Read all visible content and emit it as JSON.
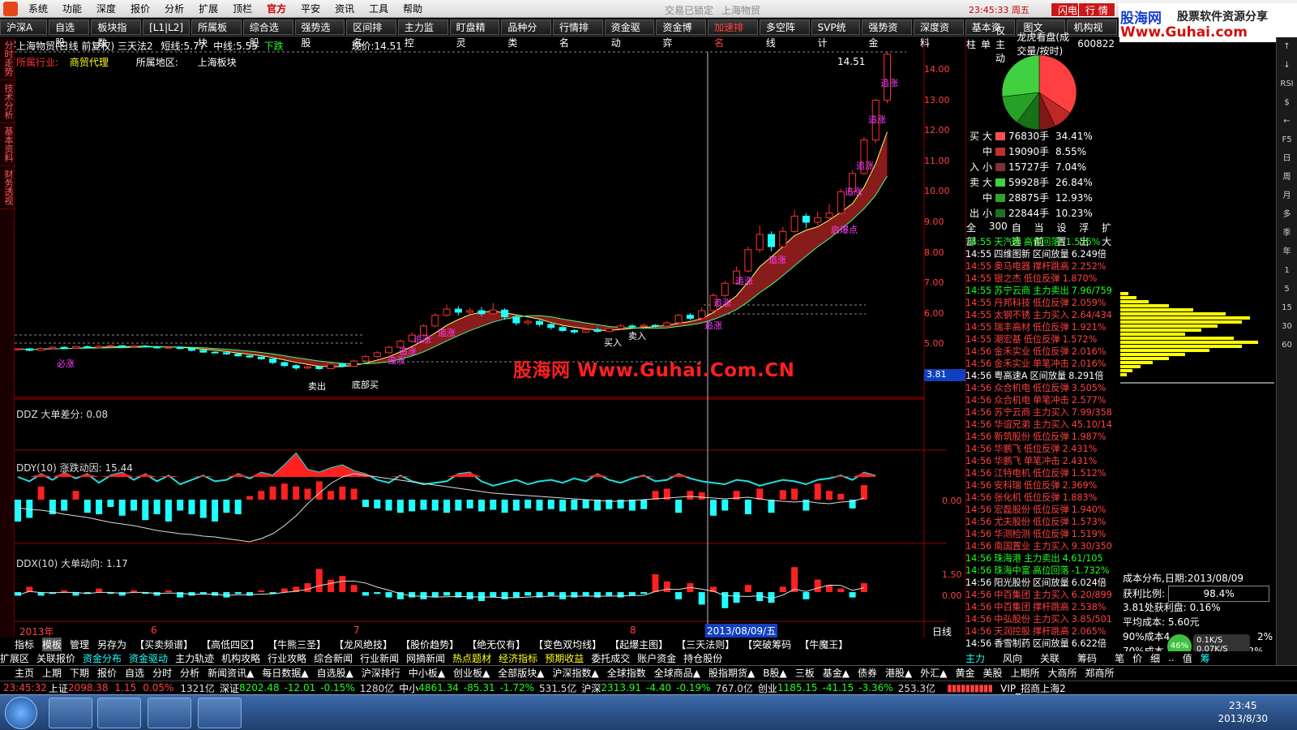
{
  "menu": [
    "系统",
    "功能",
    "深度",
    "报价",
    "分析",
    "扩展",
    "顶栏",
    "官方",
    "平安",
    "资讯",
    "工具",
    "帮助"
  ],
  "window_status": "交易已锁定",
  "window_stock": "上海物贸",
  "clock_top": "23:45:33 周五",
  "btn_trade": "闪电手",
  "btn_quote": "行 情",
  "brand": {
    "title": "股海网",
    "subtitle": "股票软件资源分享",
    "url": "Www.Guhai.com"
  },
  "toolbar": [
    "沪深A股",
    "自选股",
    "板块指数",
    "[L1|L2]",
    "所属板块",
    "综合选股",
    "强势选股",
    "区间排名",
    "主力监控",
    "盯盘精灵",
    "品种分类",
    "行情排名",
    "资金驱动",
    "资金博弈",
    "加速排名",
    "多空阵线",
    "SVP统计",
    "强势资金",
    "深度资料",
    "基本资料",
    "图文F10",
    "机构视点"
  ],
  "left_tabs": [
    "分时走势",
    "技术分析",
    "基本资料",
    "财务透视"
  ],
  "chart_header": {
    "title": "上海物贸(日线 前复权) 三天法2",
    "short_label": "短线:",
    "short_val": "5.77",
    "mid_label": "中线:",
    "mid_val": "5.55",
    "trend": "下跌",
    "now_label": "现价:",
    "now_val": "14.51"
  },
  "industry": {
    "label": "所属行业:",
    "value": "商贸代理",
    "region_label": "所属地区:",
    "region_value": "上海板块"
  },
  "price_axis": [
    "14.00",
    "13.00",
    "12.00",
    "11.00",
    "10.00",
    "9.00",
    "8.00",
    "7.00",
    "6.00",
    "5.00"
  ],
  "price_top_label": "14.51",
  "current_price_tag": "3.81",
  "watermark": "股海网 Www.Guhai.Com.CN",
  "annotations": [
    "追涨",
    "追涨",
    "追涨",
    "追涨",
    "追涨",
    "追涨",
    "追涨",
    "启爆点",
    "追涨",
    "买入",
    "卖入",
    "追涨",
    "必涨",
    "追涨",
    "追涨",
    "追涨",
    "卖出",
    "底部买"
  ],
  "indicators": {
    "ddz_title": "DDZ 大单差分:",
    "ddz_val": "0.08",
    "ddy_title": "DDY(10) 涨跌动因:",
    "ddy_val": "15.44",
    "ddx_title": "DDX(10) 大单动向:",
    "ddx_val": "1.17",
    "ddy_axis": "0.00",
    "ddx_axis1": "1.50",
    "ddx_axis2": "0.00"
  },
  "x_axis": {
    "year": "2013年",
    "m6": "6",
    "m7": "7",
    "m8": "8",
    "cursor_date": "2013/08/09/五",
    "period": "日线"
  },
  "right_tabs": [
    "柱",
    "单",
    "仅主动",
    "龙虎看盘(成交量/按时)",
    "600822"
  ],
  "flow": {
    "buy_label": "买",
    "in_label": "入",
    "sell_label": "卖",
    "out_label": "出",
    "rows": [
      {
        "size": "大",
        "vol": "76830手",
        "pct": "34.41%",
        "color": "#ff5050"
      },
      {
        "size": "中",
        "vol": "19090手",
        "pct": "8.55%",
        "color": "#c03030"
      },
      {
        "size": "小",
        "vol": "15727手",
        "pct": "7.04%",
        "color": "#803030"
      },
      {
        "size": "大",
        "vol": "59928手",
        "pct": "26.84%",
        "color": "#40d040"
      },
      {
        "size": "中",
        "vol": "28875手",
        "pct": "12.93%",
        "color": "#30a030"
      },
      {
        "size": "小",
        "vol": "22844手",
        "pct": "10.23%",
        "color": "#207020"
      }
    ]
  },
  "pie": [
    {
      "value": 34.41,
      "color": "#ff4040"
    },
    {
      "value": 8.55,
      "color": "#c02828"
    },
    {
      "value": 7.04,
      "color": "#801818"
    },
    {
      "value": 10.23,
      "color": "#187018"
    },
    {
      "value": 12.93,
      "color": "#28a028"
    },
    {
      "value": 26.84,
      "color": "#40d040"
    }
  ],
  "alert_tabs": [
    "全部",
    "300",
    "自选",
    "当前",
    "设置",
    "浮出",
    "扩大"
  ],
  "alerts": [
    {
      "t": "14:55",
      "n": "天汽模",
      "e": "高位回落",
      "v": "-1.576%",
      "c": "#20ff20"
    },
    {
      "t": "14:55",
      "n": "四维图新",
      "e": "区间放量",
      "v": "6.249倍",
      "c": "#fff"
    },
    {
      "t": "14:55",
      "n": "奥马电器",
      "e": "撑杆跳高",
      "v": "2.252%",
      "c": "#ff4040"
    },
    {
      "t": "14:55",
      "n": "银之杰",
      "e": "低位反弹",
      "v": "1.870%",
      "c": "#ff4040"
    },
    {
      "t": "14:55",
      "n": "苏宁云商",
      "e": "主力卖出",
      "v": "7.96/759",
      "c": "#20ff20"
    },
    {
      "t": "14:55",
      "n": "丹邦科技",
      "e": "低位反弹",
      "v": "2.059%",
      "c": "#ff4040"
    },
    {
      "t": "14:55",
      "n": "太钢不锈",
      "e": "主力买入",
      "v": "2.64/434",
      "c": "#ff4040"
    },
    {
      "t": "14:55",
      "n": "瑞丰高材",
      "e": "低位反弹",
      "v": "1.921%",
      "c": "#ff4040"
    },
    {
      "t": "14:55",
      "n": "潮宏基",
      "e": "低位反弹",
      "v": "1.572%",
      "c": "#ff4040"
    },
    {
      "t": "14:56",
      "n": "金禾实业",
      "e": "低位反弹",
      "v": "2.016%",
      "c": "#ff4040"
    },
    {
      "t": "14:56",
      "n": "金禾实业",
      "e": "单笔冲击",
      "v": "2.016%",
      "c": "#ff4040"
    },
    {
      "t": "14:56",
      "n": "粤高速A",
      "e": "区间放量",
      "v": "8.291倍",
      "c": "#fff"
    },
    {
      "t": "14:56",
      "n": "众合机电",
      "e": "低位反弹",
      "v": "3.505%",
      "c": "#ff4040"
    },
    {
      "t": "14:56",
      "n": "众合机电",
      "e": "单笔冲击",
      "v": "2.577%",
      "c": "#ff4040"
    },
    {
      "t": "14:56",
      "n": "苏宁云商",
      "e": "主力买入",
      "v": "7.99/358",
      "c": "#ff4040"
    },
    {
      "t": "14:56",
      "n": "华谊兄弟",
      "e": "主力买入",
      "v": "45.10/14",
      "c": "#ff4040"
    },
    {
      "t": "14:56",
      "n": "新筑股份",
      "e": "低位反弹",
      "v": "1.987%",
      "c": "#ff4040"
    },
    {
      "t": "14:56",
      "n": "华鹏飞",
      "e": "低位反弹",
      "v": "2.431%",
      "c": "#ff4040"
    },
    {
      "t": "14:56",
      "n": "华鹏飞",
      "e": "单笔冲击",
      "v": "2.431%",
      "c": "#ff4040"
    },
    {
      "t": "14:56",
      "n": "江特电机",
      "e": "低位反弹",
      "v": "1.512%",
      "c": "#ff4040"
    },
    {
      "t": "14:56",
      "n": "安科瑞",
      "e": "低位反弹",
      "v": "2.369%",
      "c": "#ff4040"
    },
    {
      "t": "14:56",
      "n": "张化机",
      "e": "低位反弹",
      "v": "1.883%",
      "c": "#ff4040"
    },
    {
      "t": "14:56",
      "n": "宏磊股份",
      "e": "低位反弹",
      "v": "1.940%",
      "c": "#ff4040"
    },
    {
      "t": "14:56",
      "n": "尤夫股份",
      "e": "低位反弹",
      "v": "1.573%",
      "c": "#ff4040"
    },
    {
      "t": "14:56",
      "n": "华测检测",
      "e": "低位反弹",
      "v": "1.519%",
      "c": "#ff4040"
    },
    {
      "t": "14:56",
      "n": "南国置业",
      "e": "主力买入",
      "v": "9.30/350",
      "c": "#ff4040"
    },
    {
      "t": "14:56",
      "n": "珠海港",
      "e": "主力卖出",
      "v": "4.61/105",
      "c": "#20ff20"
    },
    {
      "t": "14:56",
      "n": "珠海中富",
      "e": "高位回落",
      "v": "-1.732%",
      "c": "#20ff20"
    },
    {
      "t": "14:56",
      "n": "阳光股份",
      "e": "区间放量",
      "v": "6.024倍",
      "c": "#fff"
    },
    {
      "t": "14:56",
      "n": "中百集团",
      "e": "主力买入",
      "v": "6.20/899",
      "c": "#ff4040"
    },
    {
      "t": "14:56",
      "n": "中百集团",
      "e": "撑杆跳高",
      "v": "2.538%",
      "c": "#ff4040"
    },
    {
      "t": "14:56",
      "n": "中弘股份",
      "e": "主力买入",
      "v": "3.85/501",
      "c": "#ff4040"
    },
    {
      "t": "14:56",
      "n": "天润控股",
      "e": "撑杆跳高",
      "v": "2.065%",
      "c": "#ff4040"
    },
    {
      "t": "14:56",
      "n": "香雪制药",
      "e": "区间放量",
      "v": "6.622倍",
      "c": "#fff"
    }
  ],
  "cost": {
    "title": "成本分布,日期:",
    "date": "2013/08/09",
    "profit_label": "获利比例:",
    "profit_val": "98.4%",
    "c1": "3.81处获利盘: 0.16%",
    "c2": "平均成本: 5.60元",
    "c3": "90%成本4.",
    "c3b": "2%",
    "c4": "70%成本",
    "c4b": "2%"
  },
  "netspeed": {
    "pct": "46%",
    "up": "0.1K/S",
    "down": "0.07K/S"
  },
  "bottom_tabs": [
    "指标",
    "模板",
    "管理",
    "另存为",
    "【买卖频谱】",
    "【高低四区】",
    "【牛熊三圣】",
    "【龙风绝技】",
    "【股价趋势】",
    "【绝无仅有】",
    "【变色双均线】",
    "【起爆主图】",
    "【三天法则】",
    "【突破筹码",
    "【牛魔王】"
  ],
  "bottom_tabs2": [
    "扩展区",
    "关联报价",
    "资金分布",
    "资金驱动",
    "主力轨迹",
    "机构攻略",
    "行业攻略",
    "综合新闻",
    "行业新闻",
    "网摘新闻",
    "热点题材",
    "经济指标",
    "预期收益",
    "委托成交",
    "账户资金",
    "持仓股份"
  ],
  "right_bottom_tabs": [
    "主力",
    "风向",
    "关联",
    "筹码"
  ],
  "right_bottom_tabs_b": [
    "笔",
    "价",
    "细",
    "..",
    "值",
    "筹"
  ],
  "market_tabs": [
    "主页",
    "上期",
    "下期",
    "报价",
    "自选",
    "分时",
    "分析",
    "新闻资讯▲",
    "每日数据▲",
    "自选股▲",
    "沪深排行",
    "中小板▲",
    "创业板▲",
    "全部版块▲",
    "沪深指数▲",
    "全球指数",
    "全球商品▲",
    "股指期货▲",
    "B股▲",
    "三板",
    "基金▲",
    "债券",
    "港股▲",
    "外汇▲",
    "黄金",
    "美股",
    "上期所",
    "大商所",
    "郑商所"
  ],
  "index_bar": {
    "time": "23:45:32",
    "sh_label": "上证",
    "sh": "2098.38",
    "sh_chg": "1.15",
    "sh_pct": "0.05%",
    "sh_amt": "1321亿",
    "sz_label": "深证",
    "sz": "8202.48",
    "sz_chg": "-12.01",
    "sz_pct": "-0.15%",
    "sz_amt": "1280亿",
    "zx_label": "中小",
    "zx": "4861.34",
    "zx_chg": "-85.31",
    "zx_pct": "-1.72%",
    "zx_amt": "531.5亿",
    "hs_label": "沪深",
    "hs": "2313.91",
    "hs_chg": "-4.40",
    "hs_pct": "-0.19%",
    "hs_amt": "767.0亿",
    "cy_label": "创业",
    "cy": "1185.15",
    "cy_chg": "-41.15",
    "cy_pct": "-3.36%",
    "cy_amt": "253.3亿",
    "vip": "VIP_招商上海2"
  },
  "right_icons": [
    "↑",
    "↓",
    "RSI",
    "$",
    "←",
    "F5",
    "日",
    "周",
    "月",
    "多",
    "季",
    "年",
    "1",
    "5",
    "15",
    "30",
    "60"
  ],
  "taskbar_clock": {
    "time": "23:45",
    "date": "2013/8/30"
  },
  "candles": [
    {
      "o": 4.82,
      "c": 4.85,
      "h": 4.88,
      "l": 4.78
    },
    {
      "o": 4.85,
      "c": 4.8,
      "h": 4.88,
      "l": 4.77
    },
    {
      "o": 4.8,
      "c": 4.86,
      "h": 4.9,
      "l": 4.78
    },
    {
      "o": 4.86,
      "c": 4.9,
      "h": 4.93,
      "l": 4.83
    },
    {
      "o": 4.9,
      "c": 4.87,
      "h": 4.94,
      "l": 4.84
    },
    {
      "o": 4.87,
      "c": 4.92,
      "h": 4.95,
      "l": 4.85
    },
    {
      "o": 4.92,
      "c": 4.89,
      "h": 4.96,
      "l": 4.86
    },
    {
      "o": 4.89,
      "c": 4.93,
      "h": 4.97,
      "l": 4.87
    },
    {
      "o": 4.93,
      "c": 4.95,
      "h": 4.99,
      "l": 4.9
    },
    {
      "o": 4.95,
      "c": 4.91,
      "h": 4.98,
      "l": 4.88
    },
    {
      "o": 4.91,
      "c": 4.94,
      "h": 4.97,
      "l": 4.89
    },
    {
      "o": 4.94,
      "c": 4.92,
      "h": 4.98,
      "l": 4.89
    },
    {
      "o": 4.92,
      "c": 4.88,
      "h": 4.95,
      "l": 4.85
    },
    {
      "o": 4.88,
      "c": 4.9,
      "h": 4.93,
      "l": 4.86
    },
    {
      "o": 4.9,
      "c": 4.86,
      "h": 4.92,
      "l": 4.83
    },
    {
      "o": 4.86,
      "c": 4.8,
      "h": 4.88,
      "l": 4.77
    },
    {
      "o": 4.8,
      "c": 4.74,
      "h": 4.82,
      "l": 4.72
    },
    {
      "o": 4.74,
      "c": 4.72,
      "h": 4.77,
      "l": 4.69
    },
    {
      "o": 4.72,
      "c": 4.68,
      "h": 4.75,
      "l": 4.65
    },
    {
      "o": 4.68,
      "c": 4.62,
      "h": 4.7,
      "l": 4.59
    },
    {
      "o": 4.62,
      "c": 4.58,
      "h": 4.64,
      "l": 4.55
    },
    {
      "o": 4.58,
      "c": 4.52,
      "h": 4.6,
      "l": 4.49
    },
    {
      "o": 4.52,
      "c": 4.4,
      "h": 4.54,
      "l": 4.35
    },
    {
      "o": 4.4,
      "c": 4.3,
      "h": 4.44,
      "l": 4.25
    },
    {
      "o": 4.3,
      "c": 4.22,
      "h": 4.35,
      "l": 4.15
    },
    {
      "o": 4.22,
      "c": 4.26,
      "h": 4.3,
      "l": 4.18
    },
    {
      "o": 4.26,
      "c": 4.2,
      "h": 4.3,
      "l": 4.16
    },
    {
      "o": 4.2,
      "c": 4.35,
      "h": 4.4,
      "l": 4.18
    },
    {
      "o": 4.35,
      "c": 4.28,
      "h": 4.4,
      "l": 4.24
    },
    {
      "o": 4.28,
      "c": 4.45,
      "h": 4.5,
      "l": 4.26
    },
    {
      "o": 4.45,
      "c": 4.6,
      "h": 4.65,
      "l": 4.42
    },
    {
      "o": 4.6,
      "c": 4.72,
      "h": 4.78,
      "l": 4.56
    },
    {
      "o": 4.72,
      "c": 4.9,
      "h": 4.95,
      "l": 4.7
    },
    {
      "o": 4.9,
      "c": 5.1,
      "h": 5.15,
      "l": 4.86
    },
    {
      "o": 5.1,
      "c": 5.3,
      "h": 5.38,
      "l": 5.05
    },
    {
      "o": 5.3,
      "c": 5.6,
      "h": 5.65,
      "l": 5.25
    },
    {
      "o": 5.6,
      "c": 5.95,
      "h": 6.02,
      "l": 5.55
    },
    {
      "o": 5.95,
      "c": 6.15,
      "h": 6.3,
      "l": 5.9
    },
    {
      "o": 6.15,
      "c": 6.05,
      "h": 6.25,
      "l": 5.95
    },
    {
      "o": 6.05,
      "c": 6.1,
      "h": 6.2,
      "l": 5.98
    },
    {
      "o": 6.1,
      "c": 6.0,
      "h": 6.22,
      "l": 5.92
    },
    {
      "o": 6.0,
      "c": 6.12,
      "h": 6.35,
      "l": 5.95
    },
    {
      "o": 6.12,
      "c": 5.9,
      "h": 6.18,
      "l": 5.8
    },
    {
      "o": 5.9,
      "c": 5.7,
      "h": 5.95,
      "l": 5.62
    },
    {
      "o": 5.7,
      "c": 5.75,
      "h": 5.82,
      "l": 5.62
    },
    {
      "o": 5.75,
      "c": 5.65,
      "h": 5.8,
      "l": 5.58
    },
    {
      "o": 5.65,
      "c": 5.55,
      "h": 5.7,
      "l": 5.48
    },
    {
      "o": 5.55,
      "c": 5.45,
      "h": 5.6,
      "l": 5.4
    },
    {
      "o": 5.45,
      "c": 5.4,
      "h": 5.5,
      "l": 5.34
    },
    {
      "o": 5.4,
      "c": 5.48,
      "h": 5.55,
      "l": 5.36
    },
    {
      "o": 5.48,
      "c": 5.42,
      "h": 5.55,
      "l": 5.38
    },
    {
      "o": 5.42,
      "c": 5.52,
      "h": 5.58,
      "l": 5.4
    },
    {
      "o": 5.52,
      "c": 5.6,
      "h": 5.66,
      "l": 5.48
    },
    {
      "o": 5.6,
      "c": 5.58,
      "h": 5.66,
      "l": 5.52
    },
    {
      "o": 5.58,
      "c": 5.62,
      "h": 5.68,
      "l": 5.54
    },
    {
      "o": 5.62,
      "c": 5.6,
      "h": 5.66,
      "l": 5.55
    },
    {
      "o": 5.6,
      "c": 5.7,
      "h": 5.76,
      "l": 5.58
    },
    {
      "o": 5.7,
      "c": 5.95,
      "h": 6.0,
      "l": 5.66
    },
    {
      "o": 5.95,
      "c": 5.85,
      "h": 6.02,
      "l": 5.78
    },
    {
      "o": 5.85,
      "c": 6.1,
      "h": 6.2,
      "l": 5.82
    },
    {
      "o": 6.1,
      "c": 6.6,
      "h": 6.68,
      "l": 6.05
    },
    {
      "o": 6.6,
      "c": 7.0,
      "h": 7.08,
      "l": 6.55
    },
    {
      "o": 7.0,
      "c": 7.4,
      "h": 7.55,
      "l": 6.95
    },
    {
      "o": 7.4,
      "c": 8.1,
      "h": 8.2,
      "l": 7.35
    },
    {
      "o": 8.1,
      "c": 8.6,
      "h": 8.9,
      "l": 8.0
    },
    {
      "o": 8.6,
      "c": 8.2,
      "h": 8.7,
      "l": 8.05
    },
    {
      "o": 8.2,
      "c": 8.7,
      "h": 8.85,
      "l": 8.15
    },
    {
      "o": 8.7,
      "c": 9.2,
      "h": 9.4,
      "l": 8.65
    },
    {
      "o": 9.2,
      "c": 9.0,
      "h": 9.3,
      "l": 8.8
    },
    {
      "o": 9.0,
      "c": 9.15,
      "h": 9.35,
      "l": 8.9
    },
    {
      "o": 9.15,
      "c": 9.3,
      "h": 9.6,
      "l": 9.05
    },
    {
      "o": 9.3,
      "c": 10.0,
      "h": 10.1,
      "l": 9.25
    },
    {
      "o": 10.0,
      "c": 10.6,
      "h": 10.7,
      "l": 9.95
    },
    {
      "o": 10.6,
      "c": 11.7,
      "h": 11.8,
      "l": 10.55
    },
    {
      "o": 11.7,
      "c": 13.0,
      "h": 13.05,
      "l": 11.6
    },
    {
      "o": 13.0,
      "c": 14.51,
      "h": 14.6,
      "l": 12.9
    }
  ],
  "ddz": [
    0,
    -0.3,
    0.2,
    -0.2,
    0.3,
    -0.1,
    0.2,
    -0.4,
    0.1,
    0.3,
    -0.2,
    0.2,
    -0.3,
    0.1,
    -0.5,
    -0.2,
    0.1,
    -0.3,
    -0.2,
    0.2,
    -0.1,
    0.3,
    0.1,
    0.8,
    1.6,
    0.5,
    0.3,
    0.6,
    0.8,
    0.4,
    0.2,
    -0.2,
    -0.4,
    0.1,
    -0.3,
    -0.5,
    -0.4,
    -0.3,
    0.2,
    0.3,
    -0.3,
    -0.6,
    -0.4,
    -0.2,
    -0.5,
    -0.3,
    -0.2,
    -0.4,
    -0.1,
    -0.3,
    0.2,
    -0.2,
    -0.4,
    -0.1,
    0.1,
    -0.3,
    -0.2,
    0.2,
    -0.1,
    -0.3,
    -0.4,
    -0.5,
    -0.2,
    -0.3,
    -0.6,
    -0.4,
    -0.2,
    -0.3,
    -0.5,
    -0.2,
    -0.1,
    0.1,
    -0.2,
    0.3,
    0.08
  ],
  "ddy": [
    -3,
    -2.5,
    1.8,
    -2,
    -1.5,
    1.2,
    -1.8,
    -2,
    -1,
    -2.2,
    -1.5,
    -2.8,
    -2,
    -3,
    -1.5,
    -2,
    -2.5,
    -3,
    -1.8,
    -2,
    0.5,
    1.2,
    1.8,
    2.2,
    1.8,
    1.5,
    2.5,
    1.2,
    1.8,
    1.5,
    -1,
    -1.2,
    -1.5,
    -1.8,
    -1.6,
    -1.4,
    -1.5,
    -1.8,
    -1.5,
    -1.2,
    -1.6,
    -1.4,
    -1.8,
    -1.5,
    -1.2,
    -1.5,
    -1.3,
    -1.6,
    -1.4,
    -1.2,
    -1.5,
    -1.3,
    -1.2,
    -1.5,
    -1.3,
    1.2,
    1.5,
    -1.8,
    1.2,
    1,
    -2.2,
    -1.5,
    1.2,
    -2,
    1.5,
    -1.8,
    1.3,
    1.5,
    -1.5,
    2.2,
    1.2,
    0.8,
    -1.2,
    2.0
  ],
  "ddy_line": [
    -1,
    -1.2,
    -1.3,
    -1.5,
    -1.8,
    -2,
    -2.2,
    -2.5,
    -2.8,
    -3,
    -3.2,
    -3.5,
    -3.8,
    -4,
    -4.2,
    -4.3,
    -4.5,
    -4.6,
    -4.8,
    -5,
    -5.2,
    -4.8,
    -4.2,
    -3.2,
    -2,
    -0.5,
    0.8,
    2,
    2.8,
    3.2,
    3.0,
    2.8,
    2.6,
    2.4,
    2.2,
    2,
    1.8,
    1.6,
    1.4,
    1.2,
    1,
    0.8,
    0.7,
    0.6,
    0.5,
    0.4,
    0.3,
    0.2,
    0.1,
    0,
    -0.1,
    -0.2,
    -0.2,
    -0.1,
    0,
    0.1,
    0.2,
    0.3,
    0.4,
    0.3,
    0.2,
    0.1,
    0.2,
    0.3,
    0.1,
    -0.1,
    -0.2,
    -0.3,
    -0.2,
    -0.4,
    -0.5,
    -0.3,
    -0.2,
    0.2
  ],
  "ddx": [
    -0.2,
    0.3,
    -0.2,
    -0.1,
    0.1,
    -0.2,
    -0.1,
    0.2,
    -0.1,
    -0.2,
    0.1,
    -0.1,
    -0.2,
    0.1,
    -0.3,
    -0.2,
    -0.1,
    -0.2,
    -0.3,
    -0.1,
    -0.2,
    0.1,
    -0.1,
    0.2,
    0.3,
    0.5,
    1.3,
    0.7,
    0.9,
    0.4,
    -0.2,
    -0.1,
    -0.3,
    -0.4,
    -0.3,
    -0.4,
    -0.3,
    -0.2,
    -0.3,
    -0.4,
    -0.5,
    -0.3,
    -0.4,
    -0.3,
    -0.2,
    -0.3,
    -0.2,
    -0.4,
    -0.3,
    -0.2,
    -0.3,
    -0.2,
    -0.3,
    -0.2,
    -0.1,
    1.0,
    0.6,
    -0.4,
    0.5,
    -0.7,
    0.3,
    -0.9,
    -0.6,
    0.4,
    -0.5,
    -0.6,
    0.3,
    1.4,
    -0.4,
    0.7,
    0.4,
    0.2,
    -0.3,
    0.5
  ]
}
